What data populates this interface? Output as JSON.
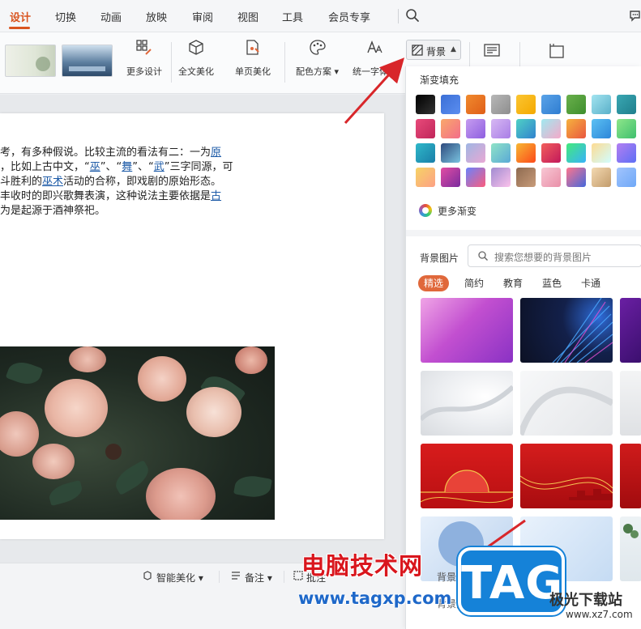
{
  "tabs": [
    {
      "label": "设计",
      "active": true
    },
    {
      "label": "切换",
      "active": false
    },
    {
      "label": "动画",
      "active": false
    },
    {
      "label": "放映",
      "active": false
    },
    {
      "label": "审阅",
      "active": false
    },
    {
      "label": "视图",
      "active": false
    },
    {
      "label": "工具",
      "active": false
    },
    {
      "label": "会员专享",
      "active": false
    }
  ],
  "ribbon": {
    "thumb_text_1": "",
    "thumb_text_2": "",
    "more_design": "更多设计",
    "full_beautify": "全文美化",
    "single_beautify": "单页美化",
    "color_scheme": "配色方案",
    "unify_font": "统一字体",
    "background": "背景"
  },
  "slide": {
    "lines": [
      [
        {
          "t": "考，有多种假说。比较主流的看法有二：一为"
        },
        {
          "t": "原",
          "link": true
        }
      ],
      [
        {
          "t": "，比如上古中文，“"
        },
        {
          "t": "巫",
          "link": true
        },
        {
          "t": "”、“"
        },
        {
          "t": "舞",
          "link": true
        },
        {
          "t": "”、“"
        },
        {
          "t": "武",
          "link": true
        },
        {
          "t": "”三字同源，可"
        }
      ],
      [
        {
          "t": "斗胜利的"
        },
        {
          "t": "巫术",
          "link": true
        },
        {
          "t": "活动的合称，即戏剧的原始形态。"
        }
      ],
      [
        {
          "t": "丰收时的即兴歌舞表演，这种说法主要依据是"
        },
        {
          "t": "古",
          "link": true
        }
      ],
      [
        {
          "t": "为是起源于酒神祭祀。"
        }
      ]
    ]
  },
  "statusbar": {
    "smart_beautify": "智能美化",
    "notes": "备注",
    "comments": "批注"
  },
  "panel": {
    "gradient_title": "渐变填充",
    "more_gradients": "更多渐变",
    "bg_image_label": "背景图片",
    "search_placeholder": "搜索您想要的背景图片",
    "categories": [
      {
        "label": "精选",
        "active": true
      },
      {
        "label": "简约",
        "active": false
      },
      {
        "label": "教育",
        "active": false
      },
      {
        "label": "蓝色",
        "active": false
      },
      {
        "label": "卡通",
        "active": false
      }
    ],
    "footer_1": "背景(K)",
    "footer_2": "背景另存为图片(P)..."
  },
  "watermark": {
    "cn_text": "电脑技术网",
    "url": "www.tagxp.com",
    "tag": "TAG",
    "xz_name": "极光下载站",
    "xz_url": "www.xz7.com"
  },
  "colors": {
    "accent": "#d9541f",
    "link": "#1c5aa7",
    "chip_active": "#e0683b",
    "arrow": "#d8262a"
  }
}
